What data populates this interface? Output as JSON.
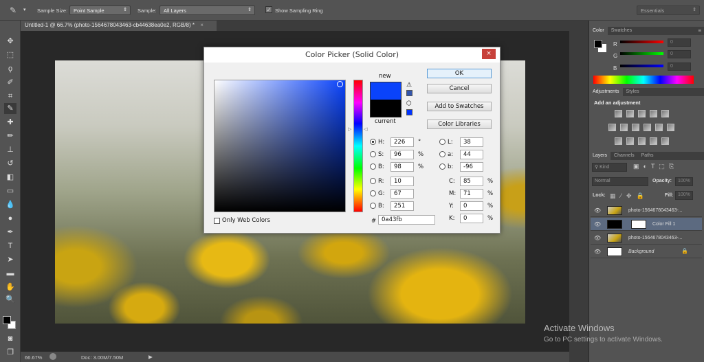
{
  "options_bar": {
    "sample_size_label": "Sample Size:",
    "sample_size_value": "Point Sample",
    "sample_label": "Sample:",
    "sample_value": "All Layers",
    "show_ring_label": "Show Sampling Ring",
    "show_ring_checked": true,
    "workspace": "Essentials"
  },
  "document_tab": {
    "title": "Untitled-1 @ 66.7% (photo-1564678043463-cb44638ea0e2, RGB/8) *",
    "close": "×"
  },
  "status_bar": {
    "zoom": "66.67%",
    "doc_size": "Doc: 3.00M/7.50M"
  },
  "color_panel": {
    "tabs": [
      "Color",
      "Swatches"
    ],
    "r_label": "R",
    "g_label": "G",
    "b_label": "B",
    "r": "0",
    "g": "0",
    "b": "0"
  },
  "adjustments_panel": {
    "tabs": [
      "Adjustments",
      "Styles"
    ],
    "heading": "Add an adjustment"
  },
  "layers_panel": {
    "tabs": [
      "Layers",
      "Channels",
      "Paths"
    ],
    "filter": "Kind",
    "blend_mode": "Normal",
    "opacity_label": "Opacity:",
    "opacity": "100%",
    "lock_label": "Lock:",
    "fill_label": "Fill:",
    "fill": "100%",
    "layers": [
      {
        "name": "photo-1564678043463-..."
      },
      {
        "name": "Color Fill 1",
        "selected": true
      },
      {
        "name": "photo-1564678043463-..."
      },
      {
        "name": "Background",
        "locked": true
      }
    ]
  },
  "dialog": {
    "title": "Color Picker (Solid Color)",
    "close": "×",
    "new_label": "new",
    "current_label": "current",
    "new_color": "#0a43fb",
    "current_color": "#000000",
    "buttons": {
      "ok": "OK",
      "cancel": "Cancel",
      "add_swatches": "Add to Swatches",
      "libraries": "Color Libraries"
    },
    "only_web": "Only Web Colors",
    "hsb": [
      {
        "label": "H:",
        "value": "226",
        "unit": "°",
        "selected": true
      },
      {
        "label": "S:",
        "value": "96",
        "unit": "%"
      },
      {
        "label": "B:",
        "value": "98",
        "unit": "%"
      }
    ],
    "rgb": [
      {
        "label": "R:",
        "value": "10"
      },
      {
        "label": "G:",
        "value": "67"
      },
      {
        "label": "B:",
        "value": "251"
      }
    ],
    "lab": [
      {
        "label": "L:",
        "value": "38"
      },
      {
        "label": "a:",
        "value": "44"
      },
      {
        "label": "b:",
        "value": "-96"
      }
    ],
    "cmyk": [
      {
        "label": "C:",
        "value": "85",
        "unit": "%"
      },
      {
        "label": "M:",
        "value": "71",
        "unit": "%"
      },
      {
        "label": "Y:",
        "value": "0",
        "unit": "%"
      },
      {
        "label": "K:",
        "value": "0",
        "unit": "%"
      }
    ],
    "hex_label": "#",
    "hex": "0a43fb"
  },
  "watermark": {
    "title": "Activate Windows",
    "subtitle": "Go to PC settings to activate Windows."
  }
}
